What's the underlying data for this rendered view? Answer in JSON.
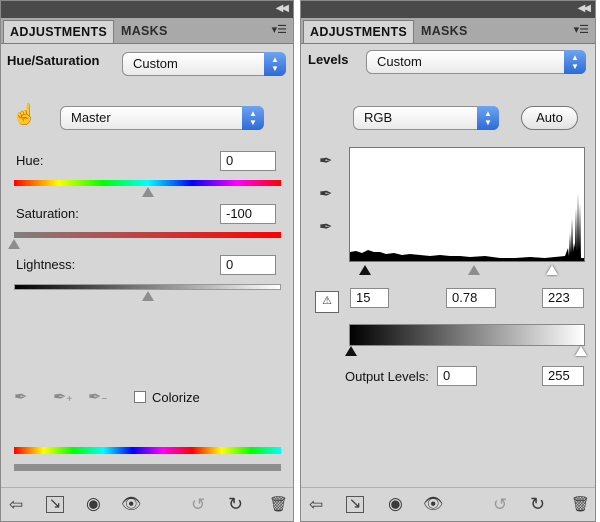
{
  "left_panel": {
    "tabs": {
      "adjustments": "ADJUSTMENTS",
      "masks": "MASKS"
    },
    "title": "Hue/Saturation",
    "preset": "Custom",
    "channel": "Master",
    "hue": {
      "label": "Hue:",
      "value": "0",
      "level": 0.5
    },
    "saturation": {
      "label": "Saturation:",
      "value": "-100",
      "level": 0.0
    },
    "lightness": {
      "label": "Lightness:",
      "value": "0",
      "level": 0.5
    },
    "colorize": {
      "label": "Colorize",
      "checked": false
    }
  },
  "right_panel": {
    "tabs": {
      "adjustments": "ADJUSTMENTS",
      "masks": "MASKS"
    },
    "title": "Levels",
    "preset": "Custom",
    "channel": "RGB",
    "auto_label": "Auto",
    "input_black": "15",
    "input_gamma": "0.78",
    "input_white": "223",
    "output_label": "Output Levels:",
    "output_black": "0",
    "output_white": "255"
  },
  "icons": {
    "hand": "targeted-adjustment-hand-icon",
    "eyedroppers": [
      "eyedropper-icon",
      "eyedropper-plus-icon",
      "eyedropper-minus-icon"
    ],
    "footer": [
      "back-arrow-icon",
      "clip-to-layer-icon",
      "view-previous-icon",
      "visibility-eye-icon",
      "reset-icon",
      "refresh-icon",
      "trash-icon"
    ]
  }
}
